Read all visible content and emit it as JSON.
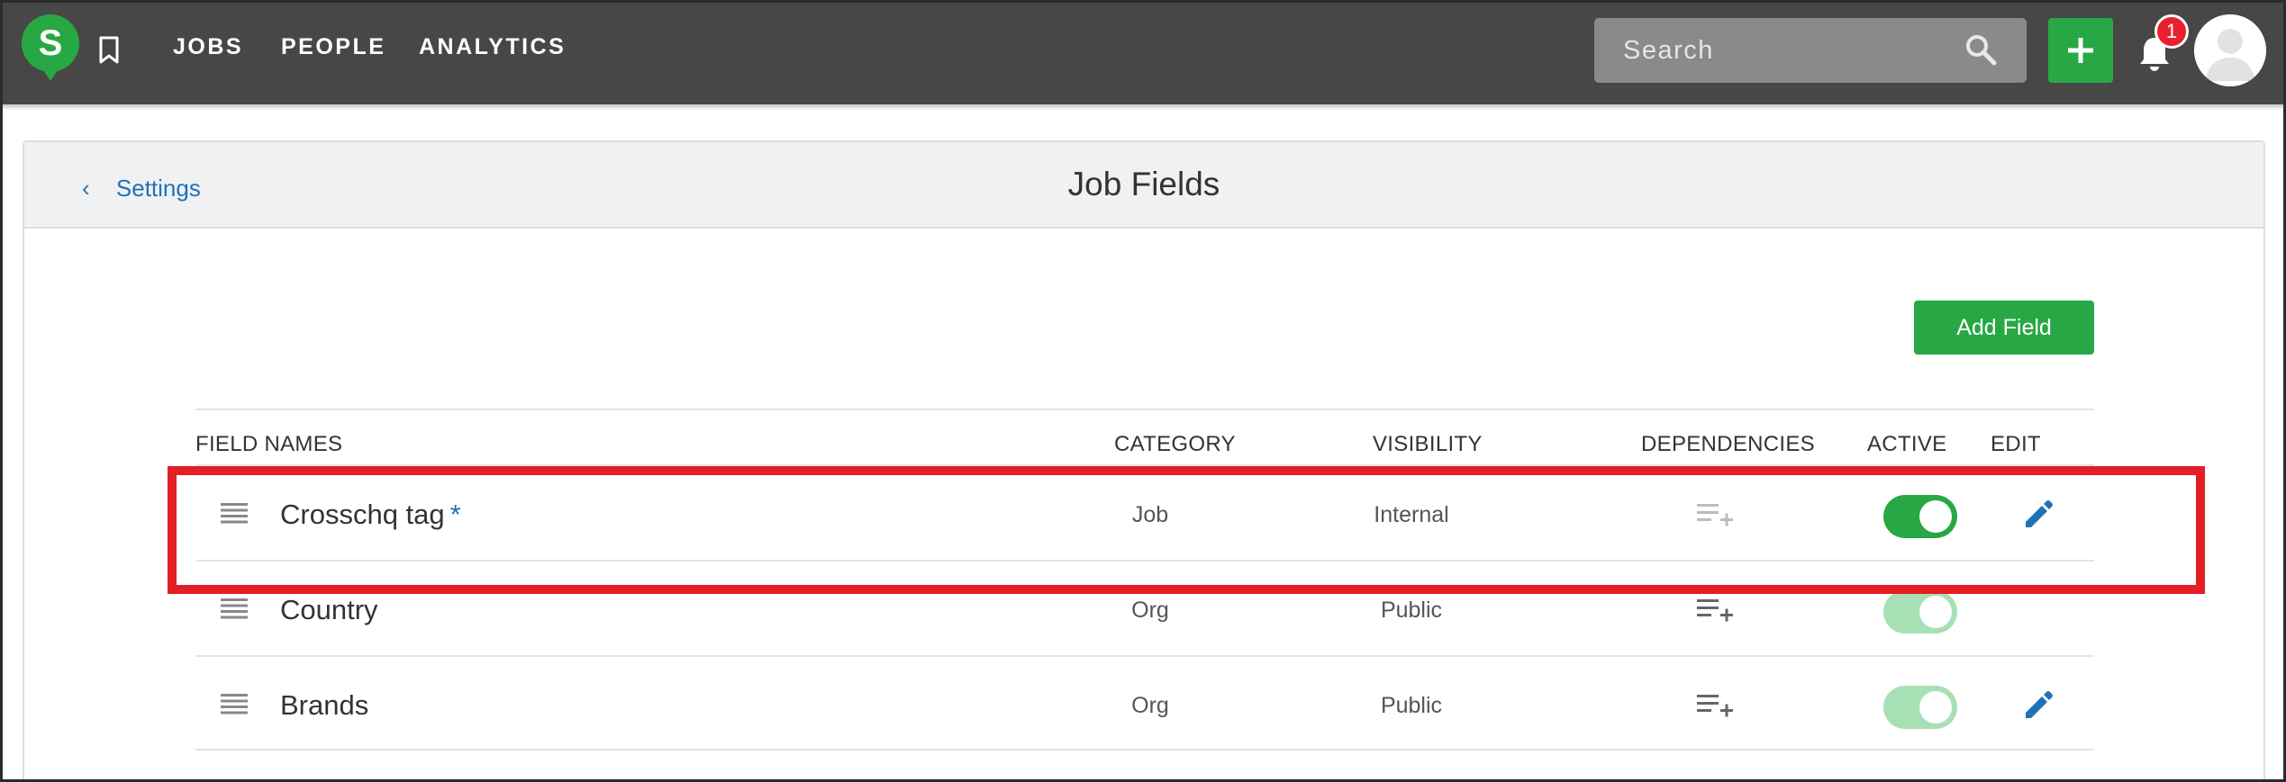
{
  "nav": {
    "logo_letter": "S",
    "links": [
      "JOBS",
      "PEOPLE",
      "ANALYTICS"
    ],
    "search_placeholder": "Search",
    "notification_count": "1"
  },
  "panel": {
    "back_label": "Settings",
    "title": "Job Fields",
    "add_field_label": "Add Field"
  },
  "table": {
    "headers": {
      "field_names": "FIELD NAMES",
      "category": "CATEGORY",
      "visibility": "VISIBILITY",
      "dependencies": "DEPENDENCIES",
      "active": "ACTIVE",
      "edit": "EDIT"
    },
    "rows": [
      {
        "name": "Crosschq tag",
        "required_mark": "*",
        "category": "Job",
        "visibility": "Internal",
        "active": true,
        "editable": true
      },
      {
        "name": "Country",
        "required_mark": "",
        "category": "Org",
        "visibility": "Public",
        "active": true,
        "editable": false
      },
      {
        "name": "Brands",
        "required_mark": "",
        "category": "Org",
        "visibility": "Public",
        "active": true,
        "editable": true
      }
    ]
  },
  "colors": {
    "topbar": "#474747",
    "brand_green": "#27a844",
    "link_blue": "#1f72b8",
    "highlight_red": "#e31e24",
    "badge_red": "#e8202f"
  },
  "icons": {
    "bookmark": "bookmark-icon",
    "search": "search-icon",
    "plus": "plus-icon",
    "bell": "bell-icon",
    "avatar": "user-avatar-icon",
    "drag": "drag-handle-icon",
    "dependencies": "playlist-add-icon",
    "edit": "pencil-icon"
  }
}
